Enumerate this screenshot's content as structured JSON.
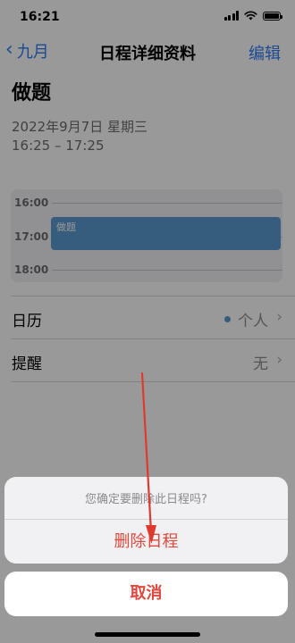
{
  "status_bar": {
    "time": "16:21"
  },
  "nav": {
    "back_label": "九月",
    "title": "日程详细资料",
    "edit_label": "编辑"
  },
  "event": {
    "title": "做题",
    "date": "2022年9月7日 星期三",
    "time_range": "16:25 – 17:25"
  },
  "day_preview": {
    "hours": [
      "16:00",
      "17:00",
      "18:00"
    ],
    "event_label": "做题"
  },
  "details": {
    "calendar": {
      "label": "日历",
      "value": "个人",
      "dot_color": "#5b9bd1"
    },
    "alert": {
      "label": "提醒",
      "value": "无"
    }
  },
  "action_sheet": {
    "message": "您确定要删除此日程吗?",
    "delete_label": "删除日程",
    "cancel_label": "取消"
  },
  "colors": {
    "accent_blue": "#2f7cf6",
    "destructive_red": "#e5463c",
    "annotation_red": "#e03a2e"
  }
}
